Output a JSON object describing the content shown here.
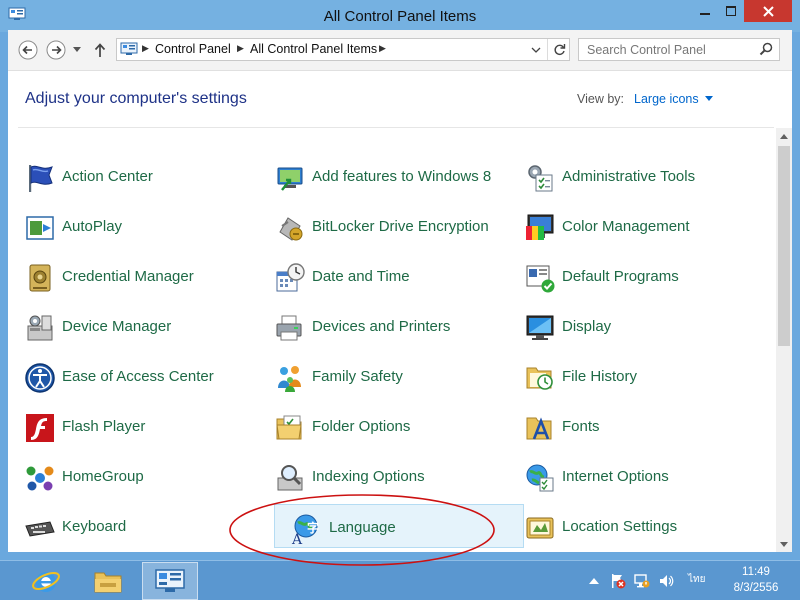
{
  "window": {
    "title": "All Control Panel Items"
  },
  "address_bar": {
    "breadcrumbs": [
      "Control Panel",
      "All Control Panel Items"
    ]
  },
  "search": {
    "placeholder": "Search Control Panel"
  },
  "header": {
    "title": "Adjust your computer's settings",
    "view_by_label": "View by:",
    "view_by_value": "Large icons"
  },
  "items": [
    {
      "label": "Action Center",
      "icon": "flag-icon"
    },
    {
      "label": "Add features to Windows 8",
      "icon": "add-features-icon"
    },
    {
      "label": "Administrative Tools",
      "icon": "admin-tools-icon"
    },
    {
      "label": "AutoPlay",
      "icon": "autoplay-icon"
    },
    {
      "label": "BitLocker Drive Encryption",
      "icon": "bitlocker-icon"
    },
    {
      "label": "Color Management",
      "icon": "color-management-icon"
    },
    {
      "label": "Credential Manager",
      "icon": "credential-vault-icon"
    },
    {
      "label": "Date and Time",
      "icon": "calendar-clock-icon"
    },
    {
      "label": "Default Programs",
      "icon": "default-programs-icon"
    },
    {
      "label": "Device Manager",
      "icon": "device-manager-icon"
    },
    {
      "label": "Devices and Printers",
      "icon": "printer-icon"
    },
    {
      "label": "Display",
      "icon": "monitor-icon"
    },
    {
      "label": "Ease of Access Center",
      "icon": "ease-of-access-icon"
    },
    {
      "label": "Family Safety",
      "icon": "family-icon"
    },
    {
      "label": "File History",
      "icon": "file-history-icon"
    },
    {
      "label": "Flash Player",
      "icon": "flash-icon"
    },
    {
      "label": "Folder Options",
      "icon": "folder-options-icon"
    },
    {
      "label": "Fonts",
      "icon": "fonts-icon"
    },
    {
      "label": "HomeGroup",
      "icon": "homegroup-icon"
    },
    {
      "label": "Indexing Options",
      "icon": "indexing-icon"
    },
    {
      "label": "Internet Options",
      "icon": "globe-icon"
    },
    {
      "label": "Keyboard",
      "icon": "keyboard-icon"
    },
    {
      "label": "Language",
      "icon": "language-icon",
      "selected": true
    },
    {
      "label": "Location Settings",
      "icon": "location-icon"
    }
  ],
  "taskbar": {
    "language_indicator": "ไทย",
    "clock_time": "11:49",
    "clock_date": "8/3/2556"
  },
  "colors": {
    "item_text": "#1e6a46",
    "header_text": "#1e3287",
    "link": "#0066cc",
    "selection_bg": "#e5f3fb",
    "annotation": "#cc1111",
    "close_button": "#c7372f"
  }
}
